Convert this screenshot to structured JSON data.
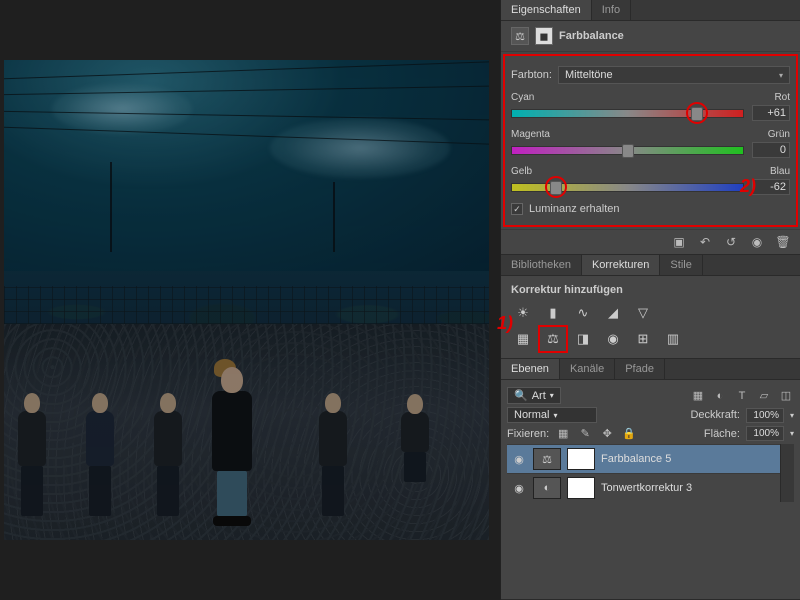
{
  "tabs_props": {
    "eigenschaften": "Eigenschaften",
    "info": "Info"
  },
  "props": {
    "title": "Farbbalance",
    "farbton_label": "Farbton:",
    "farbton_value": "Mitteltöne",
    "sliders": {
      "cr": {
        "left": "Cyan",
        "right": "Rot",
        "value": "+61",
        "pos": 80
      },
      "mg": {
        "left": "Magenta",
        "right": "Grün",
        "value": "0",
        "pos": 50
      },
      "yb": {
        "left": "Gelb",
        "right": "Blau",
        "value": "-62",
        "pos": 19
      }
    },
    "luminanz": "Luminanz erhalten"
  },
  "annotations": {
    "one": "1)",
    "two": "2)"
  },
  "tabs_korr": {
    "bibliotheken": "Bibliotheken",
    "korrekturen": "Korrekturen",
    "stile": "Stile"
  },
  "korr": {
    "heading": "Korrektur hinzufügen"
  },
  "tabs_layers": {
    "ebenen": "Ebenen",
    "kanaele": "Kanäle",
    "pfade": "Pfade"
  },
  "layers": {
    "filter": "Art",
    "blend": "Normal",
    "deckkraft_label": "Deckkraft:",
    "deckkraft_val": "100%",
    "fixieren": "Fixieren:",
    "flaeche_label": "Fläche:",
    "flaeche_val": "100%",
    "items": [
      {
        "name": "Farbbalance 5",
        "selected": true,
        "icon": "⚖"
      },
      {
        "name": "Tonwertkorrektur 3",
        "selected": false,
        "icon": "◐"
      }
    ]
  }
}
